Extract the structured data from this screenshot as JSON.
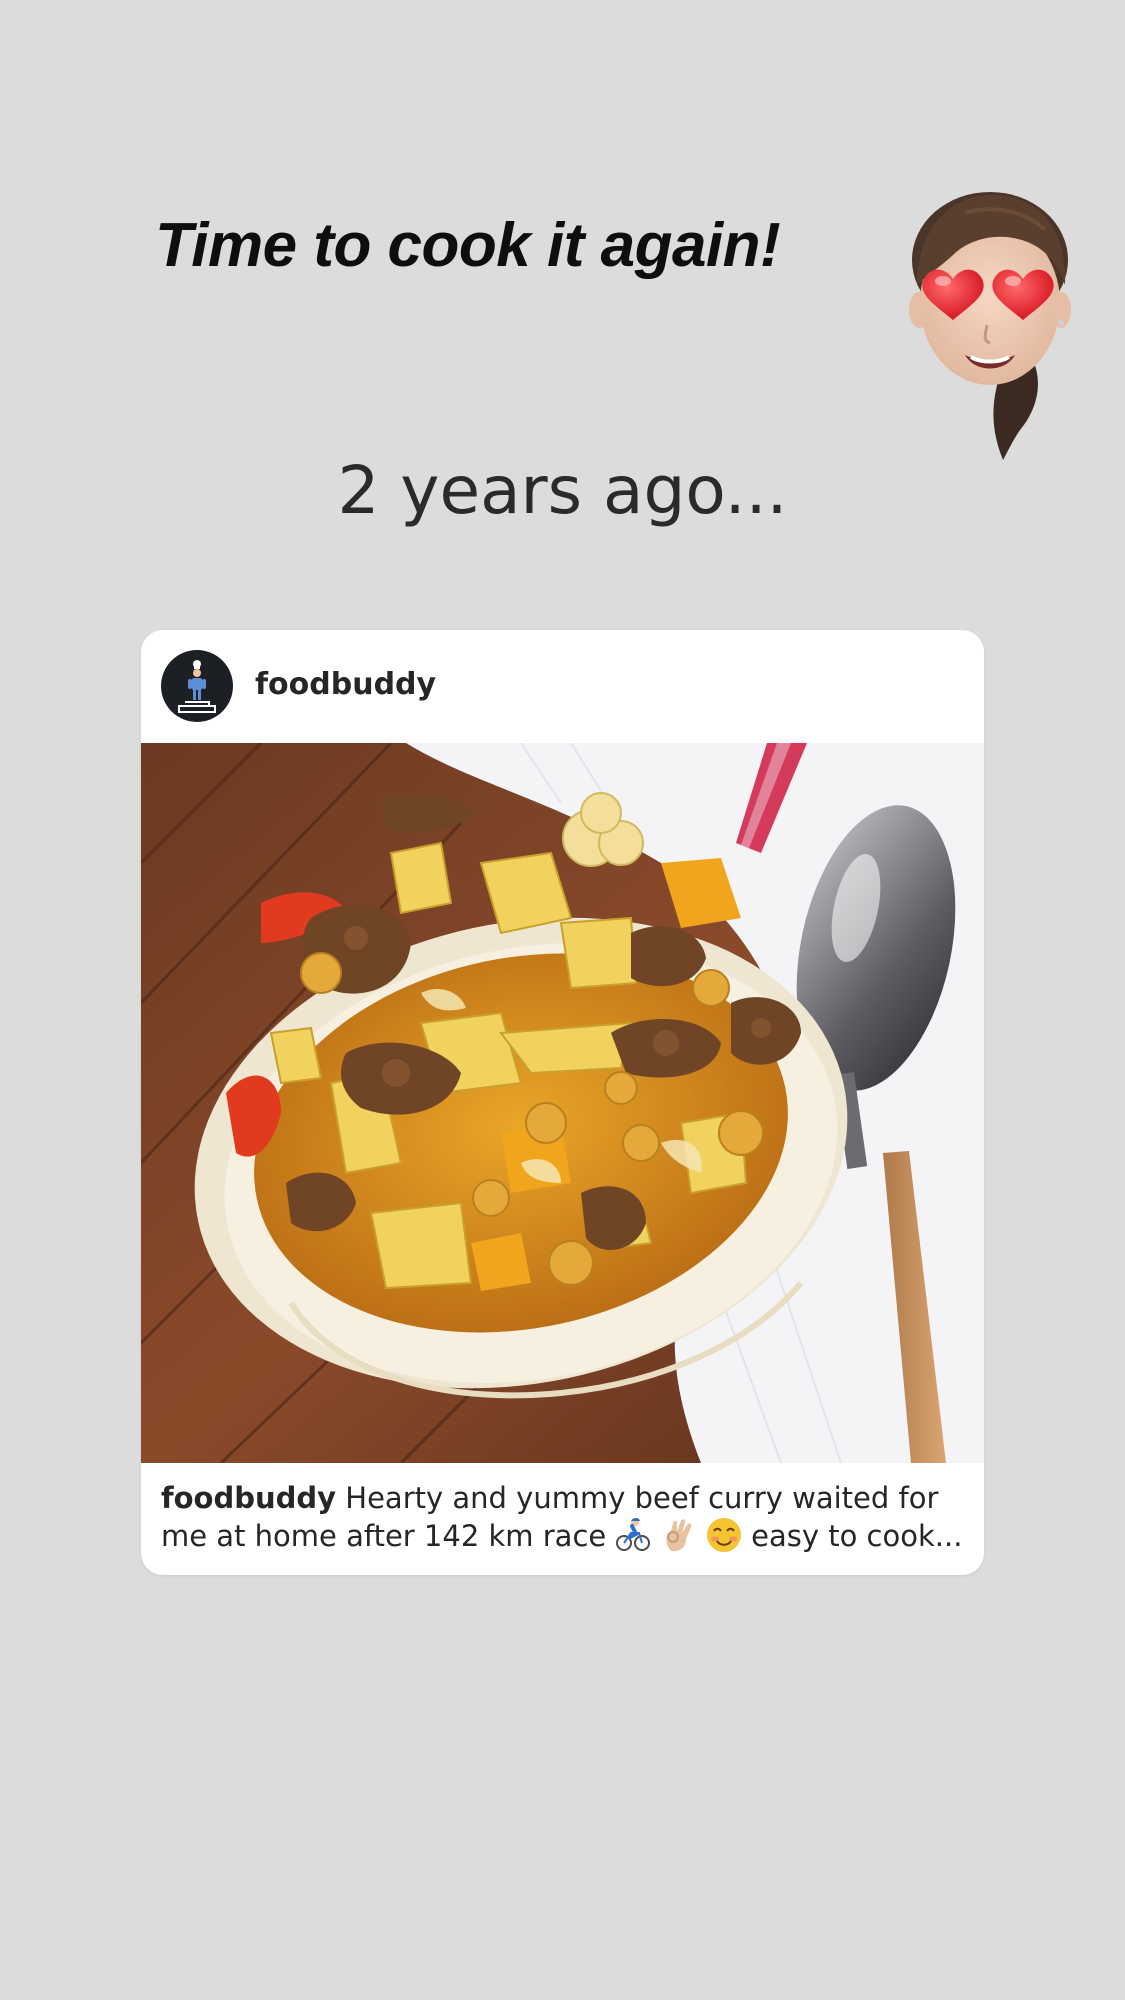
{
  "story": {
    "headline": "Time to cook it again!",
    "subheading": "2 years ago..."
  },
  "post": {
    "username": "foodbuddy",
    "caption_user": "foodbuddy",
    "caption_part1": " Hearty and yummy beef curry waited for me at home after 142 km race ",
    "caption_part2": " easy to cook...",
    "caption_emojis": [
      "cyclist-emoji",
      "ok-hand-emoji",
      "smiling-face-emoji"
    ]
  },
  "colors": {
    "background": "#dcdcdc",
    "card": "#ffffff",
    "text_primary": "#262626",
    "avatar_bg": "#1c1f24",
    "avatar_figure": "#5b8fd6"
  }
}
